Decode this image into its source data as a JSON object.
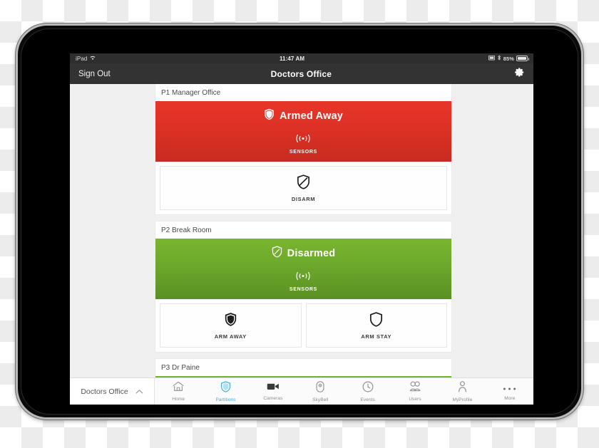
{
  "status_bar": {
    "carrier": "iPad",
    "wifi_icon": "wifi-icon",
    "time": "11:47 AM",
    "screen_mirror_icon": "screen-mirroring-icon",
    "bluetooth_icon": "bluetooth-icon",
    "battery_percent": "85%",
    "battery_icon": "battery-icon"
  },
  "nav_bar": {
    "sign_out_label": "Sign Out",
    "title": "Doctors Office",
    "settings_icon": "gear-icon"
  },
  "colors": {
    "armed_red_top": "#e8352a",
    "armed_red_bottom": "#c72b20",
    "disarmed_green_top": "#7ab52f",
    "disarmed_green_bottom": "#5a9024",
    "accent_blue": "#3eaadc",
    "nav_bar_bg": "#333333",
    "status_bar_bg": "#2e2e2e",
    "page_bg": "#f0f0f0"
  },
  "partitions": [
    {
      "title": "P1 Manager Office",
      "state": "armed",
      "state_label": "Armed Away",
      "state_icon": "shield-filled-icon",
      "sensors_icon": "sensors-signal-icon",
      "sensors_label": "SENSORS",
      "actions": [
        {
          "label": "DISARM",
          "icon": "shield-slash-icon"
        }
      ]
    },
    {
      "title": "P2 Break Room",
      "state": "disarmed",
      "state_label": "Disarmed",
      "state_icon": "shield-outline-icon",
      "sensors_icon": "sensors-signal-icon",
      "sensors_label": "SENSORS",
      "actions": [
        {
          "label": "ARM AWAY",
          "icon": "shield-filled-icon"
        },
        {
          "label": "ARM STAY",
          "icon": "shield-outline-icon"
        }
      ]
    },
    {
      "title": "P3 Dr Paine",
      "state": "disarmed",
      "state_label": "",
      "state_icon": "",
      "sensors_icon": "",
      "sensors_label": "",
      "actions": []
    }
  ],
  "tab_bar": {
    "site_name": "Doctors Office",
    "site_chevron_icon": "chevron-up-icon",
    "tabs": [
      {
        "label": "Home",
        "icon": "home-icon",
        "active": false
      },
      {
        "label": "Partitions",
        "icon": "shield-icon",
        "active": true
      },
      {
        "label": "Cameras",
        "icon": "video-camera-icon",
        "active": false
      },
      {
        "label": "SkyBell",
        "icon": "doorbell-icon",
        "active": false
      },
      {
        "label": "Events",
        "icon": "clock-icon",
        "active": false
      },
      {
        "label": "Users",
        "icon": "users-icon",
        "active": false
      },
      {
        "label": "MyProfile",
        "icon": "person-icon",
        "active": false
      },
      {
        "label": "More",
        "icon": "ellipsis-icon",
        "active": false
      }
    ]
  }
}
